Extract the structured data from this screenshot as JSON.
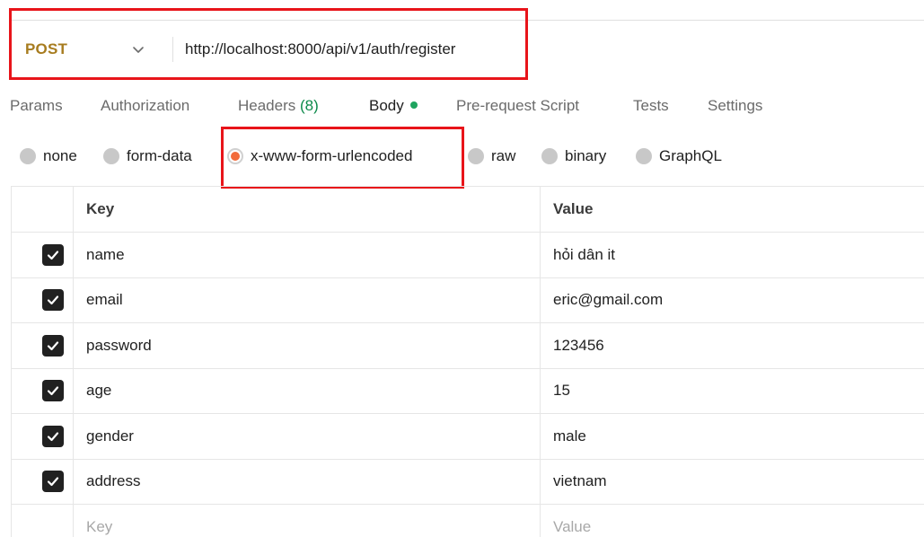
{
  "request": {
    "method": "POST",
    "url": "http://localhost:8000/api/v1/auth/register"
  },
  "tabs": [
    {
      "label": "Params"
    },
    {
      "label": "Authorization"
    },
    {
      "label": "Headers",
      "count": "(8)"
    },
    {
      "label": "Body"
    },
    {
      "label": "Pre-request Script"
    },
    {
      "label": "Tests"
    },
    {
      "label": "Settings"
    }
  ],
  "active_tab": "Body",
  "body_types": [
    {
      "label": "none"
    },
    {
      "label": "form-data"
    },
    {
      "label": "x-www-form-urlencoded"
    },
    {
      "label": "raw"
    },
    {
      "label": "binary"
    },
    {
      "label": "GraphQL"
    }
  ],
  "selected_body_type": "x-www-form-urlencoded",
  "table": {
    "headers": {
      "key": "Key",
      "value": "Value"
    },
    "rows": [
      {
        "key": "name",
        "value": "hỏi dân it",
        "checked": true
      },
      {
        "key": "email",
        "value": "eric@gmail.com",
        "checked": true
      },
      {
        "key": "password",
        "value": "123456",
        "checked": true
      },
      {
        "key": "age",
        "value": "15",
        "checked": true
      },
      {
        "key": "gender",
        "value": "male",
        "checked": true
      },
      {
        "key": "address",
        "value": "vietnam",
        "checked": true
      }
    ],
    "placeholder": {
      "key": "Key",
      "value": "Value"
    }
  },
  "colors": {
    "method": "#a77c1f",
    "highlight": "#e8141a",
    "radio_selected": "#f26b3a",
    "body_dot": "#1fa45f",
    "headers_count": "#0c8a4a"
  },
  "icons": {
    "method_dropdown": "chevron-down-icon",
    "row_checkbox": "checkbox-checked-icon"
  }
}
